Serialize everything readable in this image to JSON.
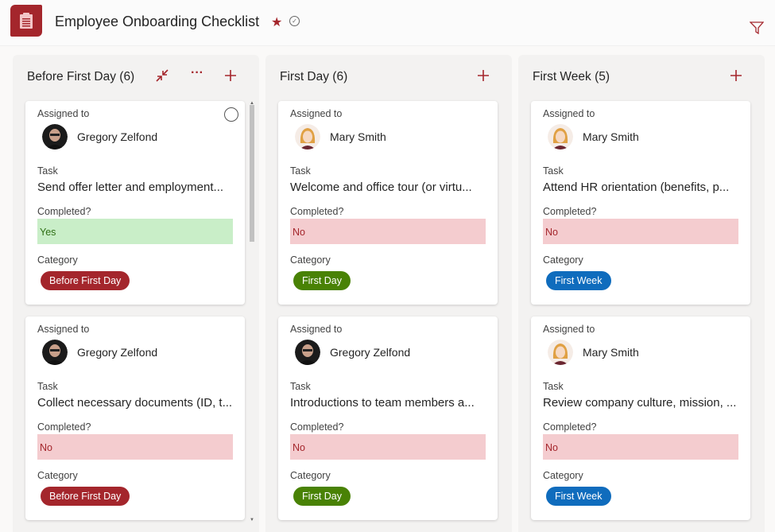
{
  "header": {
    "title": "Employee Onboarding Checklist",
    "icons": {
      "app": "clipboard-icon",
      "favorite": "star-icon",
      "verified": "check-circle-icon",
      "filter": "filter-icon"
    }
  },
  "labels": {
    "assigned_to": "Assigned to",
    "task": "Task",
    "completed": "Completed?",
    "category": "Category"
  },
  "colors": {
    "accent": "#a4262c",
    "before_first_day": "#a4262c",
    "first_day": "#498205",
    "first_week": "#0f6cbd",
    "yes_bg": "#c9eec8",
    "no_bg": "#f4cccf"
  },
  "columns": [
    {
      "title": "Before First Day (6)",
      "cards": [
        {
          "assigned_to": "Gregory Zelfond",
          "task": "Send offer letter and employment...",
          "completed": "Yes",
          "category": "Before First Day"
        },
        {
          "assigned_to": "Gregory Zelfond",
          "task": "Collect necessary documents (ID, t...",
          "completed": "No",
          "category": "Before First Day"
        }
      ]
    },
    {
      "title": "First Day (6)",
      "cards": [
        {
          "assigned_to": "Mary Smith",
          "task": "Welcome and office tour (or virtu...",
          "completed": "No",
          "category": "First Day"
        },
        {
          "assigned_to": "Gregory Zelfond",
          "task": "Introductions to team members a...",
          "completed": "No",
          "category": "First Day"
        }
      ]
    },
    {
      "title": "First Week (5)",
      "cards": [
        {
          "assigned_to": "Mary Smith",
          "task": "Attend HR orientation (benefits, p...",
          "completed": "No",
          "category": "First Week"
        },
        {
          "assigned_to": "Mary Smith",
          "task": "Review company culture, mission, ...",
          "completed": "No",
          "category": "First Week"
        }
      ]
    }
  ]
}
